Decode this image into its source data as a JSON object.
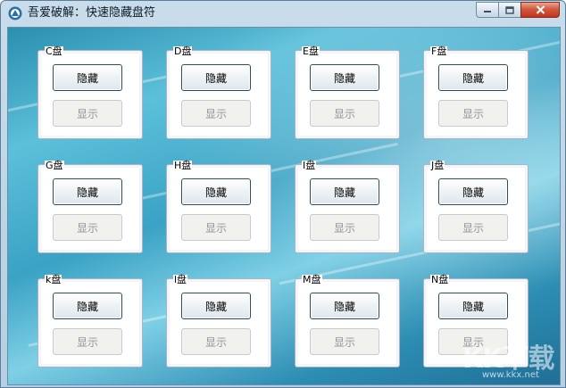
{
  "window": {
    "title": "吾爱破解：快速隐藏盘符",
    "controls": [
      "minimize-icon",
      "maximize-icon",
      "close-icon"
    ]
  },
  "colors": {
    "accent": "#2f4c66",
    "disabled_text": "#8f969c",
    "close": "#c1361b"
  },
  "drives": [
    {
      "label": "C盘",
      "hide": "隐藏",
      "show": "显示"
    },
    {
      "label": "D盘",
      "hide": "隐藏",
      "show": "显示"
    },
    {
      "label": "E盘",
      "hide": "隐藏",
      "show": "显示"
    },
    {
      "label": "F盘",
      "hide": "隐藏",
      "show": "显示"
    },
    {
      "label": "G盘",
      "hide": "隐藏",
      "show": "显示"
    },
    {
      "label": "H盘",
      "hide": "隐藏",
      "show": "显示"
    },
    {
      "label": "I盘",
      "hide": "隐藏",
      "show": "显示"
    },
    {
      "label": "J盘",
      "hide": "隐藏",
      "show": "显示"
    },
    {
      "label": "k盘",
      "hide": "隐藏",
      "show": "显示"
    },
    {
      "label": "l盘",
      "hide": "隐藏",
      "show": "显示"
    },
    {
      "label": "M盘",
      "hide": "隐藏",
      "show": "显示"
    },
    {
      "label": "N盘",
      "hide": "隐藏",
      "show": "显示"
    }
  ],
  "watermark": {
    "logo": "KK下载",
    "domain": "www.kkx.net"
  }
}
